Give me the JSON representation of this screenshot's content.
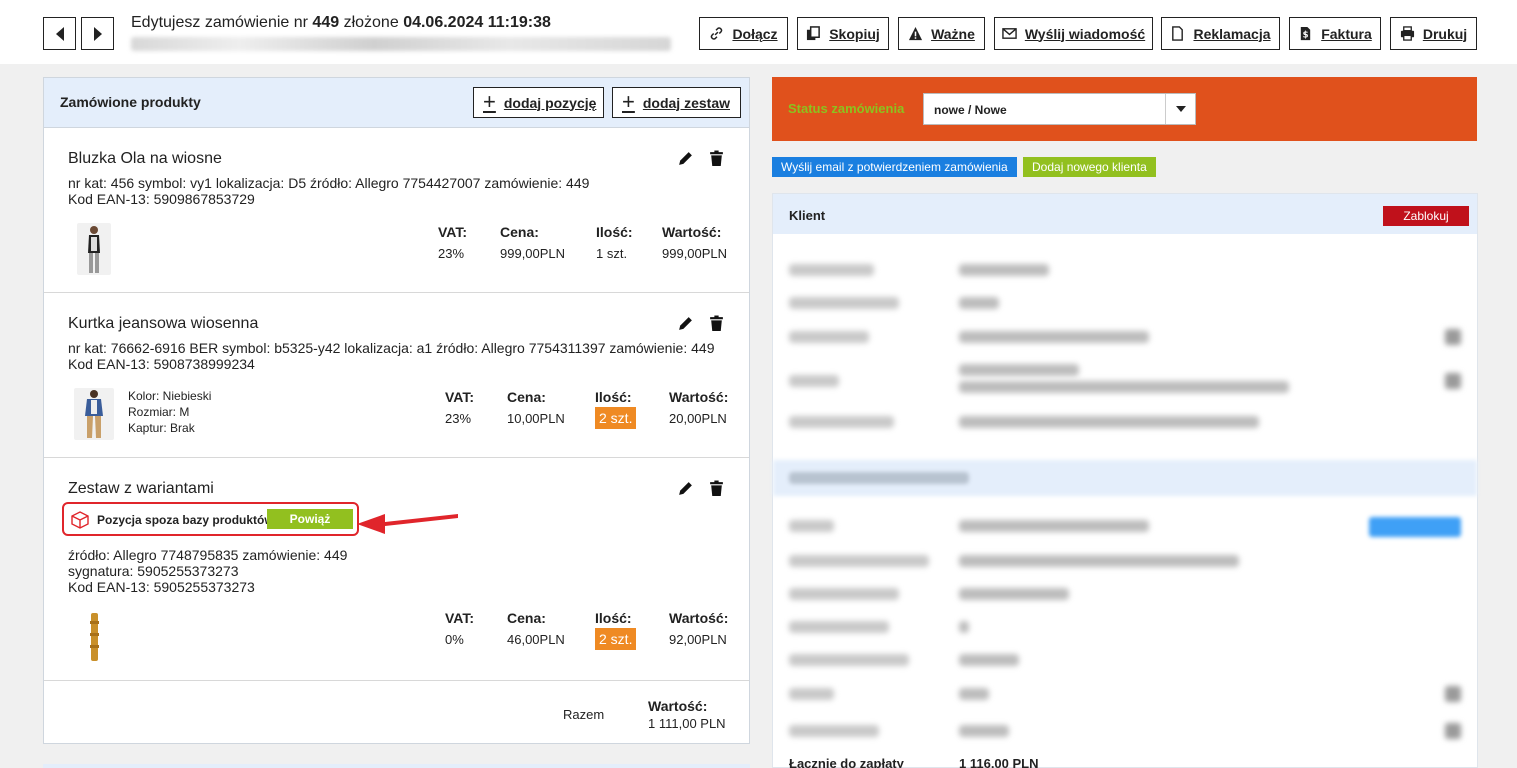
{
  "header": {
    "title_prefix": "Edytujesz zamówienie nr",
    "order_number": "449",
    "title_mid": "złożone",
    "order_date": "04.06.2024 11:19:38",
    "buttons": {
      "attach": "Dołącz",
      "copy": "Skopiuj",
      "important": "Ważne",
      "send_message": "Wyślij wiadomość",
      "complaint": "Reklamacja",
      "invoice": "Faktura",
      "print": "Drukuj"
    }
  },
  "products": {
    "title": "Zamówione produkty",
    "add_item": "dodaj pozycję",
    "add_set": "dodaj zestaw",
    "headers": {
      "vat": "VAT:",
      "price": "Cena:",
      "qty": "Ilość:",
      "value": "Wartość:"
    },
    "items": [
      {
        "name": "Bluzka Ola na wiosne",
        "line1": "nr kat: 456 symbol: vy1 lokalizacja: D5 źródło: Allegro 7754427007 zamówienie: 449",
        "line2": "Kod EAN-13: 5909867853729",
        "vat": "23%",
        "price": "999,00PLN",
        "qty": "1 szt.",
        "value": "999,00PLN"
      },
      {
        "name": "Kurtka jeansowa wiosenna",
        "line1": "nr kat: 76662-6916 BER symbol: b5325-y42 lokalizacja: a1 źródło: Allegro 7754311397 zamówienie: 449",
        "line2": "Kod EAN-13: 5908738999234",
        "attr1": "Kolor: Niebieski",
        "attr2": "Rozmiar: M",
        "attr3": "Kaptur: Brak",
        "vat": "23%",
        "price": "10,00PLN",
        "qty": "2 szt.",
        "value": "20,00PLN"
      },
      {
        "name": "Zestaw z wariantami",
        "outside_label": "Pozycja spoza bazy produktów",
        "link_button": "Powiąż",
        "line1": "źródło: Allegro 7748795835 zamówienie: 449",
        "line2": "sygnatura: 5905255373273",
        "line3": "Kod EAN-13: 5905255373273",
        "vat": "0%",
        "price": "46,00PLN",
        "qty": "2 szt.",
        "value": "92,00PLN"
      }
    ],
    "summary": {
      "label": "Razem",
      "value_header": "Wartość:",
      "value": "1 111,00 PLN"
    }
  },
  "status": {
    "label": "Status zamówienia",
    "selected": "nowe / Nowe",
    "send_email": "Wyślij email z potwierdzeniem zamówienia",
    "add_client": "Dodaj nowego klienta"
  },
  "client": {
    "title": "Klient",
    "block_button": "Zablokuj",
    "total_label": "Łącznie do zapłaty",
    "total_value": "1 116,00 PLN"
  },
  "colors": {
    "status_bar": "#e0511c",
    "status_label": "#8cc21f",
    "qty_badge": "#ef8a23",
    "link_green": "#92c01f",
    "email_chip": "#1a7fe0",
    "client_chip": "#92c01f",
    "block_red": "#c0111b",
    "highlight_red": "#e0252b"
  }
}
